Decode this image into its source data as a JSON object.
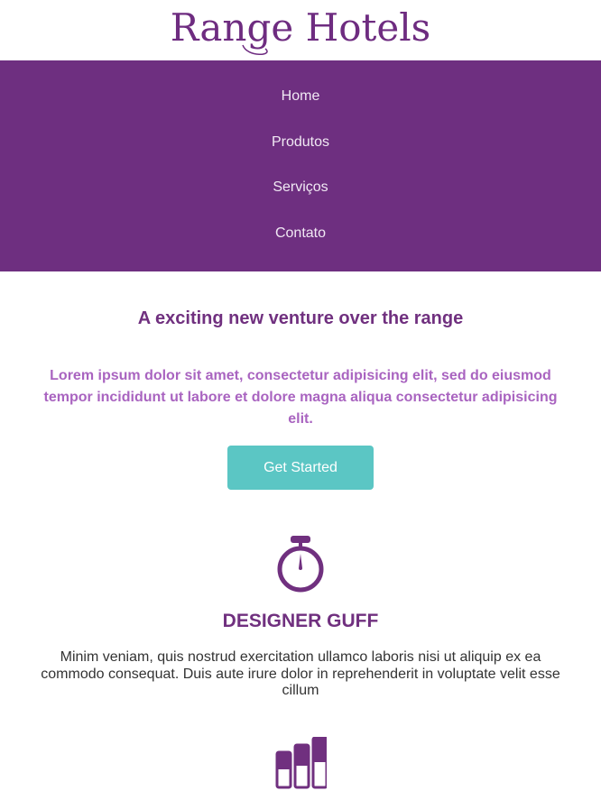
{
  "header": {
    "logo_text": "Range Hotels"
  },
  "nav": {
    "items": [
      {
        "label": "Home"
      },
      {
        "label": "Produtos"
      },
      {
        "label": "Serviços"
      },
      {
        "label": "Contato"
      }
    ]
  },
  "hero": {
    "title": "A exciting new venture over the range",
    "text": "Lorem ipsum dolor sit amet, consectetur adipisicing elit, sed do eiusmod tempor incididunt ut labore et dolore magna aliqua consectetur adipisicing elit.",
    "cta_label": "Get Started"
  },
  "features": [
    {
      "icon": "stopwatch-icon",
      "title": "DESIGNER GUFF",
      "text": "Minim veniam, quis nostrud exercitation ullamco laboris nisi ut aliquip ex ea commodo consequat. Duis aute irure dolor in reprehenderit in voluptate velit esse cillum"
    },
    {
      "icon": "bar-levels-icon"
    }
  ],
  "colors": {
    "brand_purple": "#6e2f80",
    "lorem_purple": "#a964c0",
    "cta_teal": "#5bc6c4"
  }
}
